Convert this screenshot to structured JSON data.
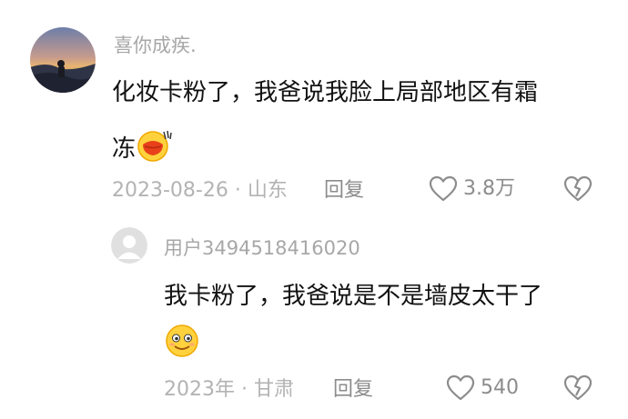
{
  "colors": {
    "username": "#a7a7a7",
    "text": "#121212",
    "meta": "#b3b3b3",
    "action": "#8c8c8c",
    "emoji_fill": "#ffd23d",
    "emoji_outline": "#f0a800",
    "lips": "#e8401a"
  },
  "comment": {
    "username": "喜你成疾.",
    "text_line1": "化妆卡粉了，我爸说我脸上局部地区有霜",
    "text_line2": "冻",
    "emoji": "kiss-lips-emoji",
    "meta": "2023-08-26 · 山东",
    "reply_label": "回复",
    "like_count": "3.8万"
  },
  "reply": {
    "username": "用户3494518416020",
    "text": "我卡粉了，我爸说是不是墙皮太干了",
    "emoji": "smiling-face-emoji",
    "meta": "2023年 · 甘肃",
    "reply_label": "回复",
    "like_count": "540"
  }
}
